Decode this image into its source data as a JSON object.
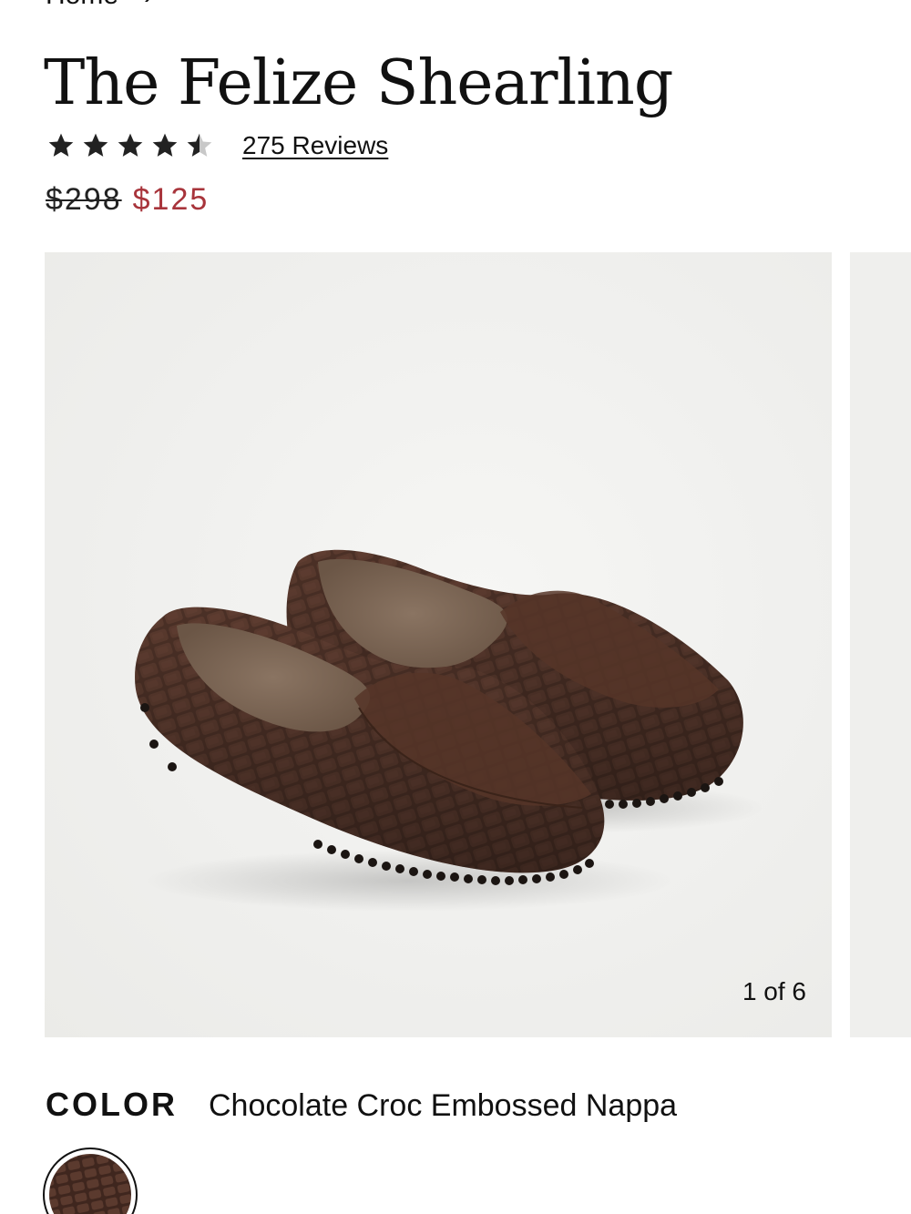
{
  "breadcrumb": {
    "home_label": "Home",
    "separator": "›"
  },
  "product": {
    "title": "The Felize Shearling",
    "rating": 4.5,
    "rating_max": 5,
    "reviews_label": "275 Reviews",
    "price_original": "$298",
    "price_sale": "$125"
  },
  "gallery": {
    "counter": "1 of 6",
    "current_image": 1,
    "total_images": 6
  },
  "color": {
    "label": "COLOR",
    "value": "Chocolate Croc Embossed Nappa",
    "swatch_color": "#4a2e24"
  },
  "colors": {
    "sale_price": "#a8343b",
    "text": "#111111",
    "image_bg": "#efefed",
    "star": "#222222"
  }
}
